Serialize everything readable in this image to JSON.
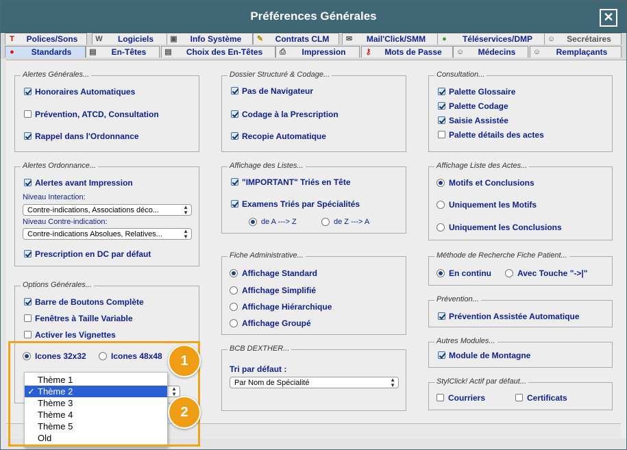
{
  "window": {
    "title": "Préférences Générales",
    "close": "✕"
  },
  "tabs_row1": [
    {
      "label": "Polices/Sons",
      "icon": "font-icon"
    },
    {
      "label": "Logiciels",
      "icon": "w-icon"
    },
    {
      "label": "Info Système",
      "icon": "system-icon"
    },
    {
      "label": "Contrats CLM",
      "icon": "pencil-icon"
    },
    {
      "label": "Mail'Click/SMM",
      "icon": "mail-icon"
    },
    {
      "label": "Téléservices/DMP",
      "icon": "globe-icon"
    },
    {
      "label": "Secrétaires",
      "icon": "user-icon"
    }
  ],
  "tabs_row2": [
    {
      "label": "Standards",
      "icon": "red-dot-icon"
    },
    {
      "label": "En-Têtes",
      "icon": "doc-icon"
    },
    {
      "label": "Choix des En-Têtes",
      "icon": "doc-icon"
    },
    {
      "label": "Impression",
      "icon": "printer-icon"
    },
    {
      "label": "Mots de Passe",
      "icon": "key-icon"
    },
    {
      "label": "Médecins",
      "icon": "user-icon"
    },
    {
      "label": "Remplaçants",
      "icon": "user-icon"
    }
  ],
  "alertes_generales": {
    "title": "Alertes Générales...",
    "items": [
      {
        "label": "Honoraires Automatiques",
        "checked": true
      },
      {
        "label": "Prévention, ATCD, Consultation",
        "checked": false
      },
      {
        "label": "Rappel dans l'Ordonnance",
        "checked": true
      }
    ]
  },
  "alertes_ordonnance": {
    "title": "Alertes Ordonnance...",
    "alertes_avant": {
      "label": "Alertes avant Impression",
      "checked": true
    },
    "niveau_interaction_label": "Niveau Interaction:",
    "niveau_interaction_value": "Contre-indications, Associations déco...",
    "niveau_ci_label": "Niveau Contre-indication:",
    "niveau_ci_value": "Contre-indications Absolues, Relatives...",
    "prescription_dc": {
      "label": "Prescription en DC par défaut",
      "checked": true
    }
  },
  "options_generales": {
    "title": "Options Générales...",
    "items": [
      {
        "label": "Barre de Boutons Complète",
        "checked": true
      },
      {
        "label": "Fenêtres à Taille Variable",
        "checked": false
      },
      {
        "label": "Activer les Vignettes",
        "checked": false
      }
    ],
    "icones_32": {
      "label": "Icones 32x32",
      "selected": true
    },
    "icones_48": {
      "label": "Icones 48x48",
      "selected": false
    }
  },
  "theme_menu": {
    "items": [
      "Thème 1",
      "Thème 2",
      "Thème 3",
      "Thème 4",
      "Thème 5",
      "Old"
    ],
    "selected_index": 1,
    "check": "✓"
  },
  "dossier_structure": {
    "title": "Dossier Structuré & Codage...",
    "items": [
      {
        "label": "Pas de Navigateur",
        "checked": true
      },
      {
        "label": "Codage à la Prescription",
        "checked": true
      },
      {
        "label": "Recopie Automatique",
        "checked": true
      }
    ]
  },
  "affichage_listes": {
    "title": "Affichage des Listes...",
    "items": [
      {
        "label": "\"IMPORTANT\" Triés en Tête",
        "checked": true
      },
      {
        "label": "Examens Triés par Spécialités",
        "checked": true
      }
    ],
    "order_a": {
      "label": "de A ---> Z",
      "selected": true
    },
    "order_z": {
      "label": "de Z ---> A",
      "selected": false
    }
  },
  "fiche_administrative": {
    "title": "Fiche Administrative...",
    "items": [
      {
        "label": "Affichage Standard",
        "selected": true
      },
      {
        "label": "Affichage Simplifié",
        "selected": false
      },
      {
        "label": "Affichage Hiérarchique",
        "selected": false
      },
      {
        "label": "Affichage Groupé",
        "selected": false
      }
    ]
  },
  "bcb_dexther": {
    "title": "BCB DEXTHER...",
    "tri_label": "Tri par défaut :",
    "tri_value": "Par Nom de Spécialité"
  },
  "consultation": {
    "title": "Consultation...",
    "items": [
      {
        "label": "Palette Glossaire",
        "checked": true
      },
      {
        "label": "Palette Codage",
        "checked": true
      },
      {
        "label": "Saisie Assistée",
        "checked": true
      },
      {
        "label": "Palette détails des actes",
        "checked": false
      }
    ]
  },
  "affichage_actes": {
    "title": "Affichage Liste des Actes...",
    "items": [
      {
        "label": "Motifs et Conclusions",
        "selected": true
      },
      {
        "label": "Uniquement les Motifs",
        "selected": false
      },
      {
        "label": "Uniquement les Conclusions",
        "selected": false
      }
    ]
  },
  "methode_recherche": {
    "title": "Méthode de Recherche Fiche Patient...",
    "continu": {
      "label": "En continu",
      "selected": true
    },
    "touche": {
      "label": "Avec Touche \"->|\"",
      "selected": false
    }
  },
  "prevention": {
    "title": "Prévention...",
    "item": {
      "label": "Prévention Assistée Automatique",
      "checked": true
    }
  },
  "autres_modules": {
    "title": "Autres Modules...",
    "item": {
      "label": "Module de Montagne",
      "checked": true
    }
  },
  "stylclick": {
    "title": "StylClick! Actif par défaut...",
    "courriers": {
      "label": "Courriers",
      "checked": false
    },
    "certificats": {
      "label": "Certificats",
      "checked": false
    }
  },
  "callouts": {
    "one": "1",
    "two": "2"
  },
  "colors": {
    "titlebar": "#3f6775",
    "accent": "#f2a11a",
    "label": "#0f1f8c"
  }
}
